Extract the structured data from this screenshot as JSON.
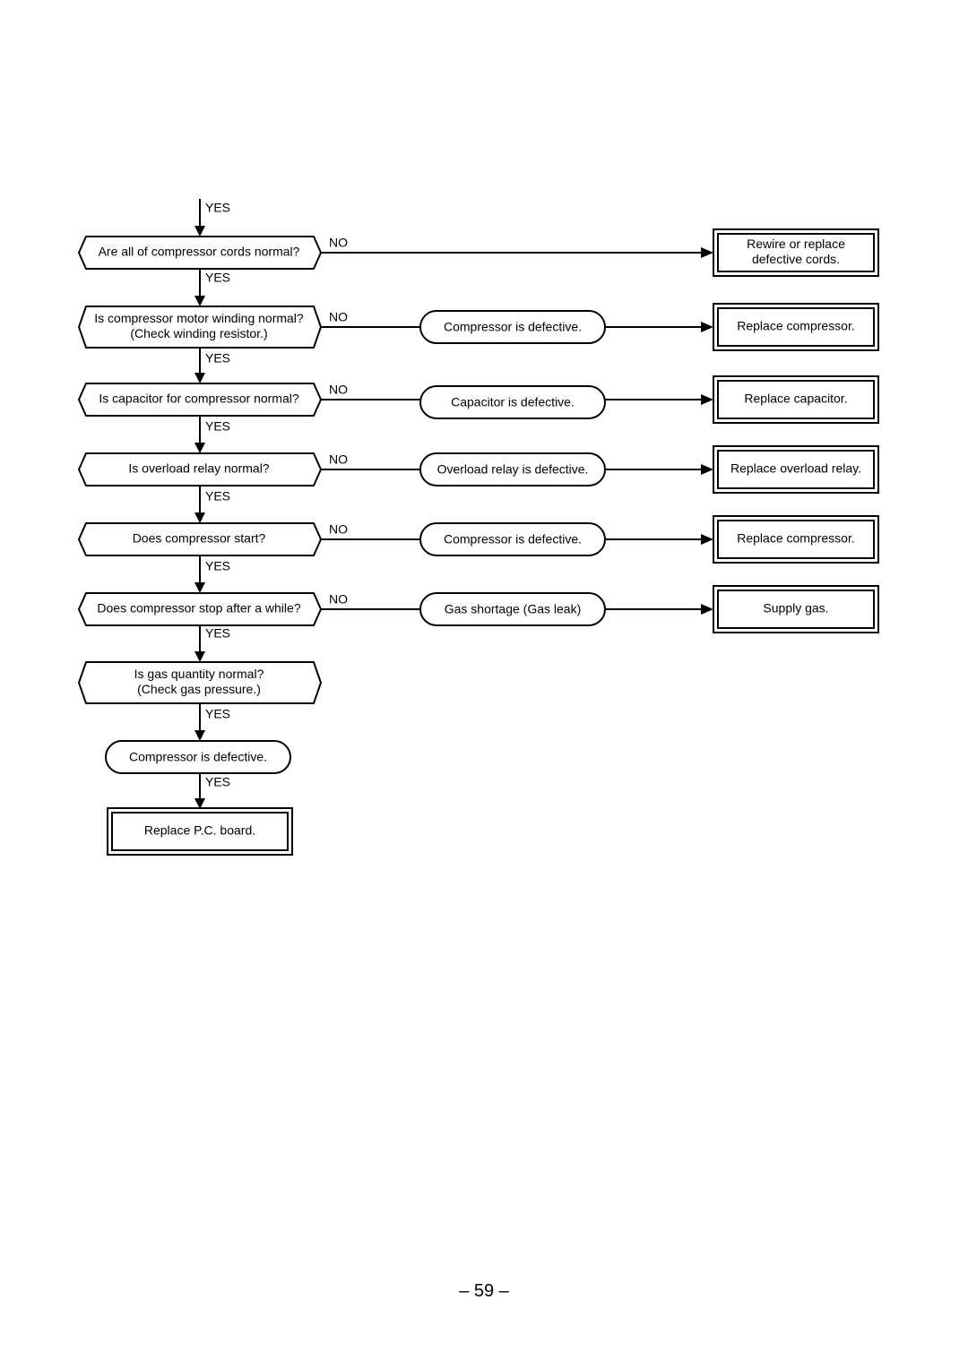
{
  "flowchart": {
    "entry_label": "YES",
    "yes_label": "YES",
    "no_label": "NO",
    "decisions": [
      {
        "lines": [
          "Are all of compressor cords normal?"
        ]
      },
      {
        "lines": [
          "Is compressor motor winding normal?",
          "(Check winding resistor.)"
        ]
      },
      {
        "lines": [
          "Is capacitor for compressor normal?"
        ]
      },
      {
        "lines": [
          "Is overload relay normal?"
        ]
      },
      {
        "lines": [
          "Does compressor start?"
        ]
      },
      {
        "lines": [
          "Does compressor stop after a while?"
        ]
      },
      {
        "lines": [
          "Is gas quantity normal?",
          "(Check gas pressure.)"
        ]
      }
    ],
    "diagnoses": [
      null,
      "Compressor is defective.",
      "Capacitor is defective.",
      "Overload relay is defective.",
      "Compressor is defective.",
      "Gas shortage (Gas leak)"
    ],
    "actions": [
      {
        "lines": [
          "Rewire or replace",
          "defective cords."
        ]
      },
      {
        "lines": [
          "Replace compressor."
        ]
      },
      {
        "lines": [
          "Replace capacitor."
        ]
      },
      {
        "lines": [
          "Replace overload relay."
        ]
      },
      {
        "lines": [
          "Replace compressor."
        ]
      },
      {
        "lines": [
          "Supply gas."
        ]
      }
    ],
    "final_diagnosis": "Compressor is defective.",
    "final_action": "Replace P.C. board."
  },
  "page_number": "– 59 –"
}
